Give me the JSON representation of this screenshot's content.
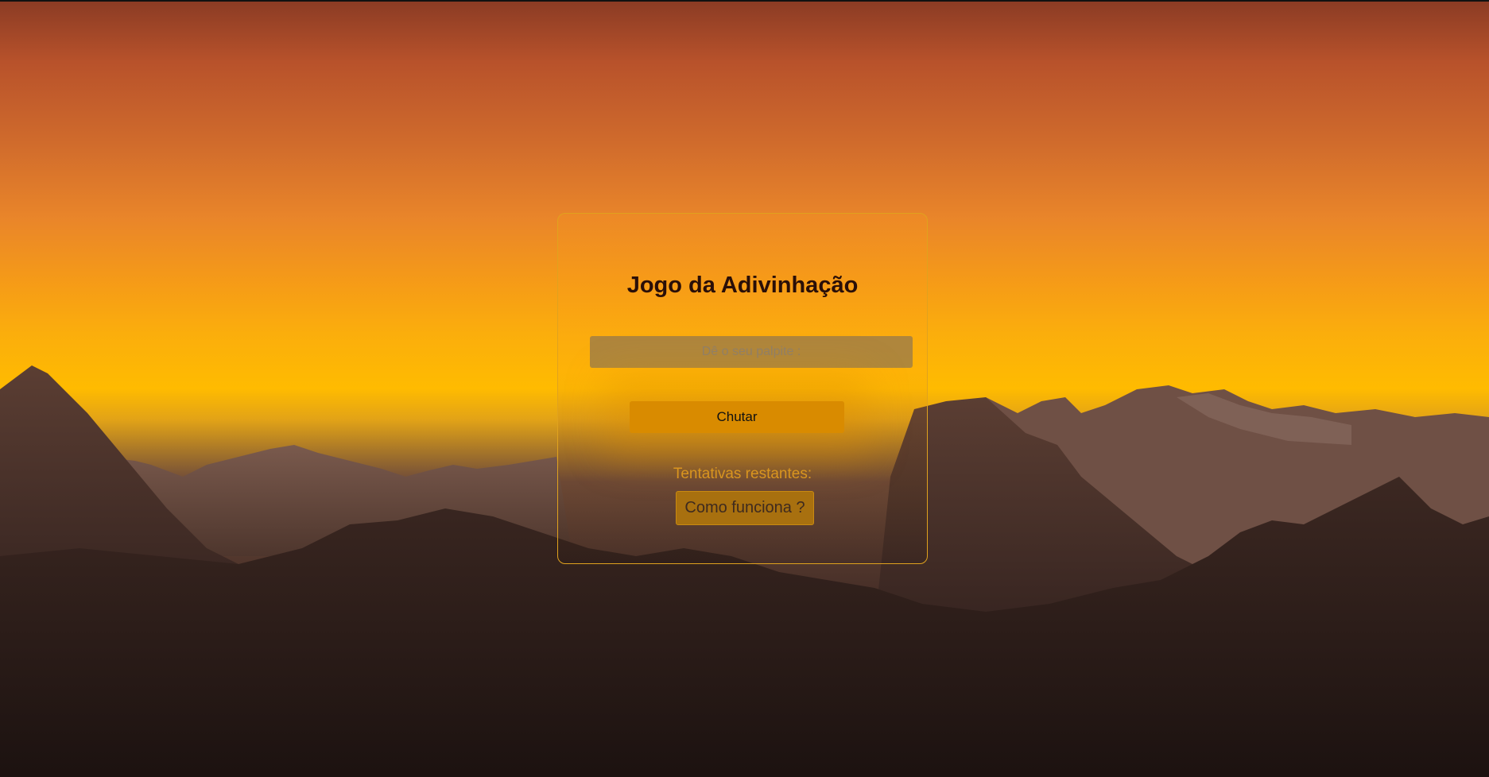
{
  "game": {
    "title": "Jogo da Adivinhação",
    "guess_placeholder": "Dê o seu palpite :",
    "guess_value": "",
    "kick_label": "Chutar",
    "attempts_label": "Tentativas restantes:",
    "how_label": "Como funciona ?"
  },
  "colors": {
    "accent": "#d98b00",
    "card_border": "#e0a21e",
    "attempts_text": "#d9951f",
    "title_text": "#2a0f08"
  }
}
